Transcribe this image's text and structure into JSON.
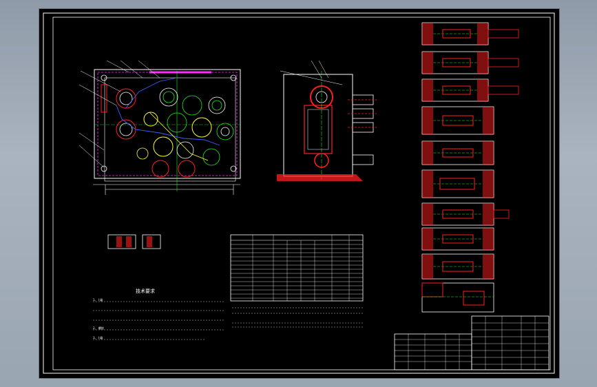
{
  "drawing": {
    "tech_title": "技术要求",
    "tech_notes": [
      "1、 I 级",
      "2、 螺纹",
      "3、 I 级"
    ],
    "table_title": "",
    "title_block": {
      "company": "",
      "drawing_no": "",
      "scale": ""
    },
    "colors": {
      "background": "#000000",
      "frame": "#ffffff",
      "red": "#ff2020",
      "green": "#22ee22",
      "yellow": "#ffff30",
      "magenta": "#ff30ff",
      "blue": "#4060ff",
      "cyan": "#30e0ff"
    }
  }
}
